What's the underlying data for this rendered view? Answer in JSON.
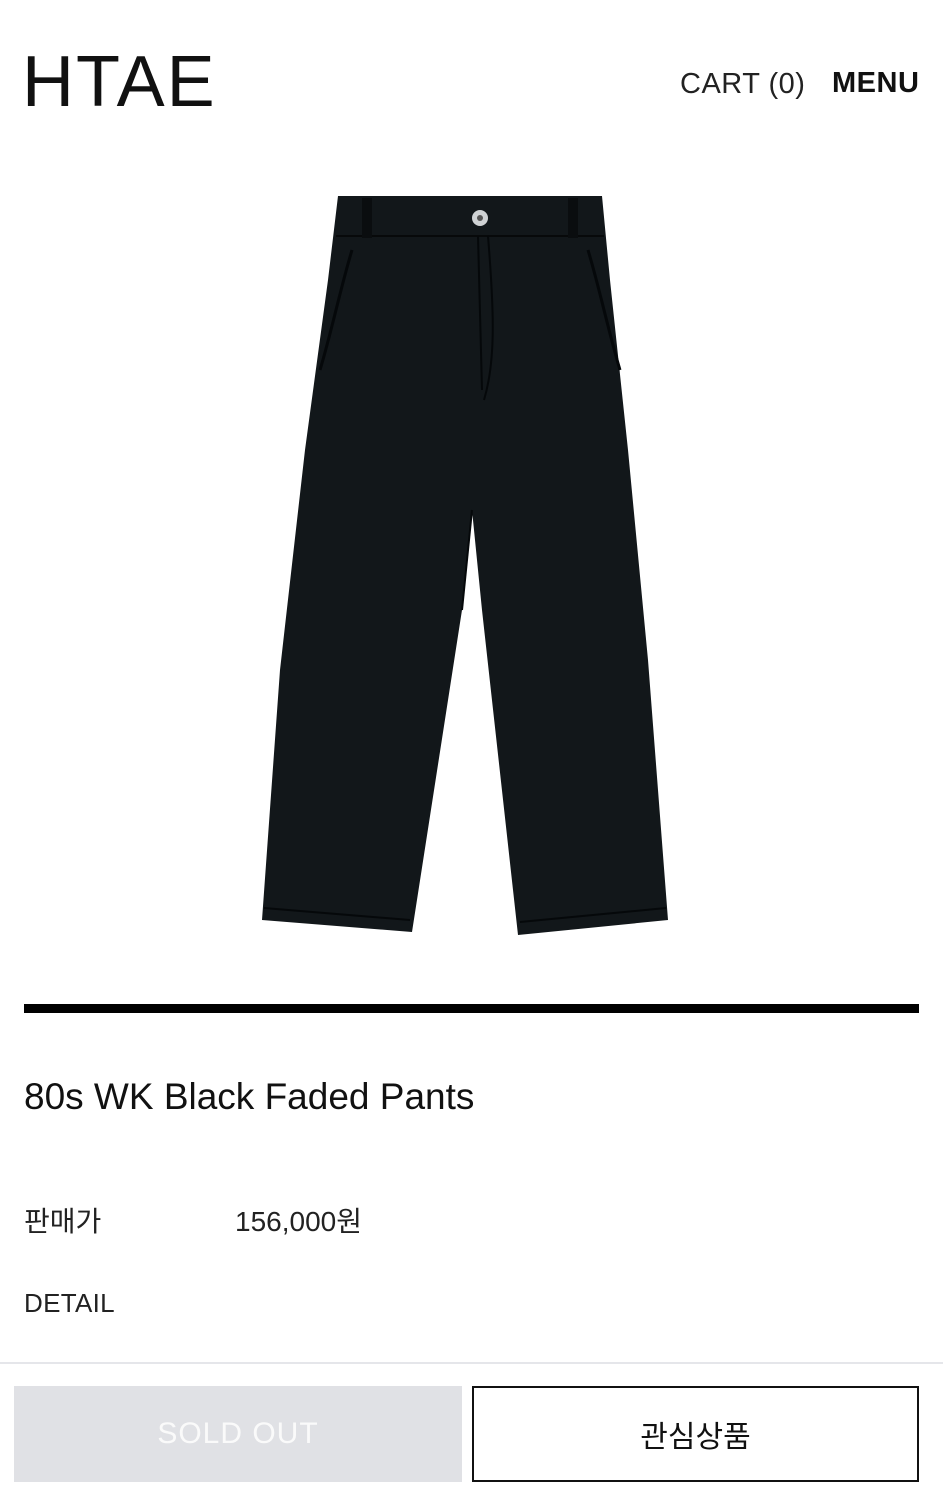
{
  "header": {
    "logo": "HTAE",
    "cart_label": "CART (0)",
    "menu_label": "MENU"
  },
  "product": {
    "image_name": "black-pants-photo",
    "name": "80s WK Black Faded Pants",
    "price_label": "판매가",
    "price_value": "156,000원",
    "detail_label": "DETAIL"
  },
  "actions": {
    "soldout_label": "SOLD OUT",
    "wishlist_label": "관심상품"
  },
  "colors": {
    "pants": "#12171a",
    "soldout_bg": "#e0e1e5",
    "divider": "#000000"
  }
}
